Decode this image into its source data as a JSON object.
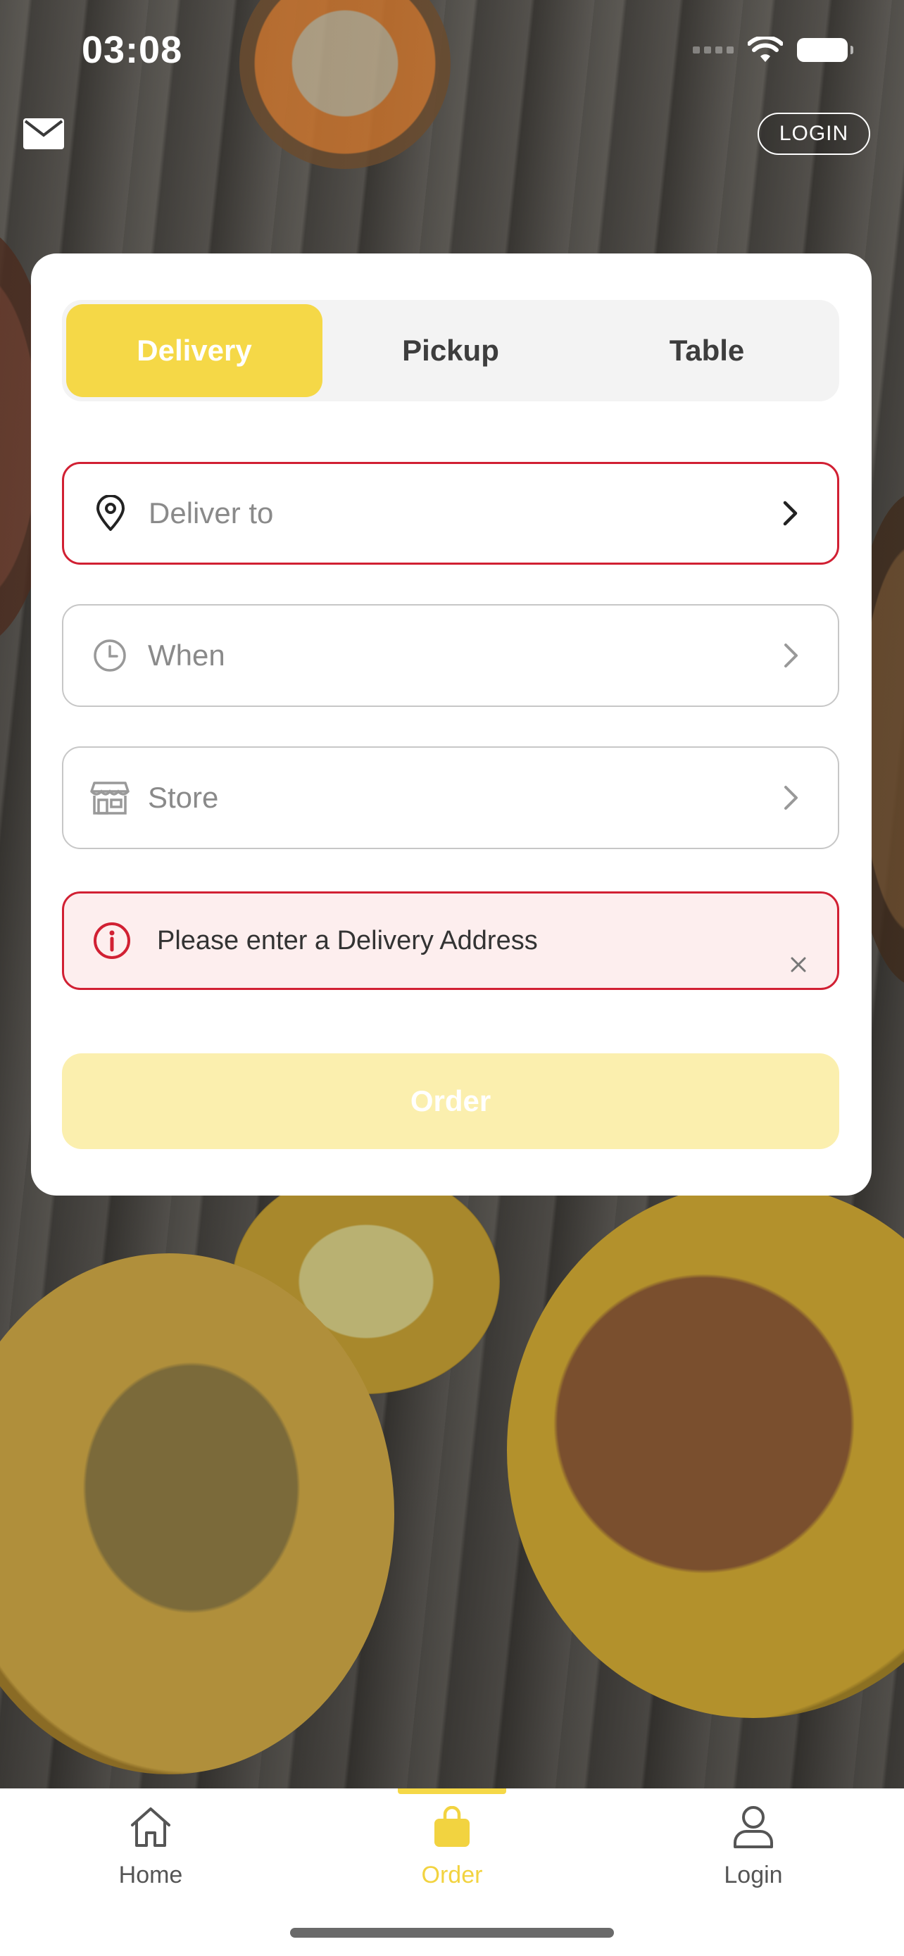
{
  "status_bar": {
    "time": "03:08"
  },
  "header": {
    "login_label": "LOGIN"
  },
  "order_type": {
    "tabs": [
      {
        "label": "Delivery",
        "active": true
      },
      {
        "label": "Pickup",
        "active": false
      },
      {
        "label": "Table",
        "active": false
      }
    ]
  },
  "fields": {
    "deliver_to": {
      "label": "Deliver to",
      "icon": "location-pin-icon",
      "state": "error"
    },
    "when": {
      "label": "When",
      "icon": "clock-icon"
    },
    "store": {
      "label": "Store",
      "icon": "storefront-icon"
    }
  },
  "alert": {
    "message": "Please enter a Delivery Address",
    "icon": "info-icon"
  },
  "order_button": {
    "label": "Order",
    "enabled": false
  },
  "bottom_nav": {
    "items": [
      {
        "label": "Home",
        "icon": "home-icon",
        "active": false
      },
      {
        "label": "Order",
        "icon": "shopping-bag-icon",
        "active": true
      },
      {
        "label": "Login",
        "icon": "user-icon",
        "active": false
      }
    ]
  },
  "colors": {
    "accent": "#f5d847",
    "accent_light": "#fbefae",
    "error": "#d12033",
    "error_bg": "#fdeeee"
  }
}
